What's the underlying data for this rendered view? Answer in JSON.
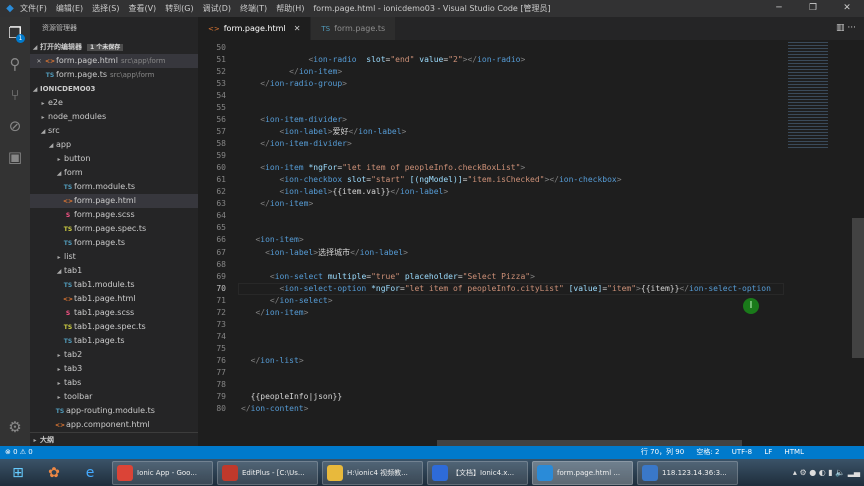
{
  "titlebar": {
    "menu": [
      "文件(F)",
      "编辑(E)",
      "选择(S)",
      "查看(V)",
      "转到(G)",
      "调试(D)",
      "终端(T)",
      "帮助(H)"
    ],
    "title": "form.page.html - ionicdemo03 - Visual Studio Code [管理员]"
  },
  "activity": {
    "explorer_badge": "1"
  },
  "sidebar": {
    "header": "资源管理器",
    "open_editors": {
      "label": "打开的编辑器",
      "unsaved": "1 个未保存",
      "items": [
        {
          "name": "form.page.html",
          "path": "src\\app\\form",
          "type": "html"
        },
        {
          "name": "form.page.ts",
          "path": "src\\app\\form",
          "type": "ts"
        }
      ]
    },
    "project": "IONICDEMO03",
    "tree": [
      {
        "name": "e2e",
        "kind": "folder",
        "depth": 1,
        "open": false
      },
      {
        "name": "node_modules",
        "kind": "folder",
        "depth": 1,
        "open": false
      },
      {
        "name": "src",
        "kind": "folder",
        "depth": 1,
        "open": true
      },
      {
        "name": "app",
        "kind": "folder",
        "depth": 2,
        "open": true
      },
      {
        "name": "button",
        "kind": "folder",
        "depth": 3,
        "open": false
      },
      {
        "name": "form",
        "kind": "folder",
        "depth": 3,
        "open": true
      },
      {
        "name": "form.module.ts",
        "kind": "ts",
        "depth": 4
      },
      {
        "name": "form.page.html",
        "kind": "html",
        "depth": 4,
        "selected": true
      },
      {
        "name": "form.page.scss",
        "kind": "scss",
        "depth": 4
      },
      {
        "name": "form.page.spec.ts",
        "kind": "spec",
        "depth": 4
      },
      {
        "name": "form.page.ts",
        "kind": "ts",
        "depth": 4
      },
      {
        "name": "list",
        "kind": "folder",
        "depth": 3,
        "open": false
      },
      {
        "name": "tab1",
        "kind": "folder",
        "depth": 3,
        "open": true
      },
      {
        "name": "tab1.module.ts",
        "kind": "ts",
        "depth": 4
      },
      {
        "name": "tab1.page.html",
        "kind": "html",
        "depth": 4
      },
      {
        "name": "tab1.page.scss",
        "kind": "scss",
        "depth": 4
      },
      {
        "name": "tab1.page.spec.ts",
        "kind": "spec",
        "depth": 4
      },
      {
        "name": "tab1.page.ts",
        "kind": "ts",
        "depth": 4
      },
      {
        "name": "tab2",
        "kind": "folder",
        "depth": 3,
        "open": false
      },
      {
        "name": "tab3",
        "kind": "folder",
        "depth": 3,
        "open": false
      },
      {
        "name": "tabs",
        "kind": "folder",
        "depth": 3,
        "open": false
      },
      {
        "name": "toolbar",
        "kind": "folder",
        "depth": 3,
        "open": false
      },
      {
        "name": "app-routing.module.ts",
        "kind": "ts",
        "depth": 3
      },
      {
        "name": "app.component.html",
        "kind": "html",
        "depth": 3
      }
    ],
    "outline": "大纲"
  },
  "tabs": [
    {
      "label": "form.page.html",
      "type": "html",
      "active": true
    },
    {
      "label": "form.page.ts",
      "type": "ts",
      "active": false
    }
  ],
  "editor": {
    "current_line": 70,
    "lines": [
      {
        "n": 50,
        "t": []
      },
      {
        "n": 51,
        "t": [
          [
            "t-txt",
            "              "
          ],
          [
            "t-br",
            "<"
          ],
          [
            "t-tag",
            "ion-radio"
          ],
          [
            "t-txt",
            "  "
          ],
          [
            "t-attr",
            "slot"
          ],
          [
            "t-txt",
            "="
          ],
          [
            "t-str",
            "\"end\""
          ],
          [
            "t-txt",
            " "
          ],
          [
            "t-attr",
            "value"
          ],
          [
            "t-txt",
            "="
          ],
          [
            "t-str",
            "\"2\""
          ],
          [
            "t-br",
            "></"
          ],
          [
            "t-tag",
            "ion-radio"
          ],
          [
            "t-br",
            ">"
          ]
        ]
      },
      {
        "n": 52,
        "t": [
          [
            "t-txt",
            "          "
          ],
          [
            "t-br",
            "</"
          ],
          [
            "t-tag",
            "ion-item"
          ],
          [
            "t-br",
            ">"
          ]
        ]
      },
      {
        "n": 53,
        "t": [
          [
            "t-txt",
            "    "
          ],
          [
            "t-br",
            "</"
          ],
          [
            "t-tag",
            "ion-radio-group"
          ],
          [
            "t-br",
            ">"
          ]
        ]
      },
      {
        "n": 54,
        "t": []
      },
      {
        "n": 55,
        "t": []
      },
      {
        "n": 56,
        "t": [
          [
            "t-txt",
            "    "
          ],
          [
            "t-br",
            "<"
          ],
          [
            "t-tag",
            "ion-item-divider"
          ],
          [
            "t-br",
            ">"
          ]
        ]
      },
      {
        "n": 57,
        "t": [
          [
            "t-txt",
            "        "
          ],
          [
            "t-br",
            "<"
          ],
          [
            "t-tag",
            "ion-label"
          ],
          [
            "t-br",
            ">"
          ],
          [
            "t-txt",
            "爱好"
          ],
          [
            "t-br",
            "</"
          ],
          [
            "t-tag",
            "ion-label"
          ],
          [
            "t-br",
            ">"
          ]
        ]
      },
      {
        "n": 58,
        "t": [
          [
            "t-txt",
            "    "
          ],
          [
            "t-br",
            "</"
          ],
          [
            "t-tag",
            "ion-item-divider"
          ],
          [
            "t-br",
            ">"
          ]
        ]
      },
      {
        "n": 59,
        "t": []
      },
      {
        "n": 60,
        "t": [
          [
            "t-txt",
            "    "
          ],
          [
            "t-br",
            "<"
          ],
          [
            "t-tag",
            "ion-item"
          ],
          [
            "t-txt",
            " "
          ],
          [
            "t-attr",
            "*ngFor"
          ],
          [
            "t-txt",
            "="
          ],
          [
            "t-str",
            "\"let item of peopleInfo.checkBoxList\""
          ],
          [
            "t-br",
            ">"
          ]
        ]
      },
      {
        "n": 61,
        "t": [
          [
            "t-txt",
            "        "
          ],
          [
            "t-br",
            "<"
          ],
          [
            "t-tag",
            "ion-checkbox"
          ],
          [
            "t-txt",
            " "
          ],
          [
            "t-attr",
            "slot"
          ],
          [
            "t-txt",
            "="
          ],
          [
            "t-str",
            "\"start\""
          ],
          [
            "t-txt",
            " "
          ],
          [
            "t-attr",
            "[(ngModel)]"
          ],
          [
            "t-txt",
            "="
          ],
          [
            "t-str",
            "\"item.isChecked\""
          ],
          [
            "t-br",
            "></"
          ],
          [
            "t-tag",
            "ion-checkbox"
          ],
          [
            "t-br",
            ">"
          ]
        ]
      },
      {
        "n": 62,
        "t": [
          [
            "t-txt",
            "        "
          ],
          [
            "t-br",
            "<"
          ],
          [
            "t-tag",
            "ion-label"
          ],
          [
            "t-br",
            ">"
          ],
          [
            "t-txt",
            "{{item.val}}"
          ],
          [
            "t-br",
            "</"
          ],
          [
            "t-tag",
            "ion-label"
          ],
          [
            "t-br",
            ">"
          ]
        ]
      },
      {
        "n": 63,
        "t": [
          [
            "t-txt",
            "    "
          ],
          [
            "t-br",
            "</"
          ],
          [
            "t-tag",
            "ion-item"
          ],
          [
            "t-br",
            ">"
          ]
        ]
      },
      {
        "n": 64,
        "t": []
      },
      {
        "n": 65,
        "t": []
      },
      {
        "n": 66,
        "t": [
          [
            "t-txt",
            "   "
          ],
          [
            "t-br",
            "<"
          ],
          [
            "t-tag",
            "ion-item"
          ],
          [
            "t-br",
            ">"
          ]
        ]
      },
      {
        "n": 67,
        "t": [
          [
            "t-txt",
            "     "
          ],
          [
            "t-br",
            "<"
          ],
          [
            "t-tag",
            "ion-label"
          ],
          [
            "t-br",
            ">"
          ],
          [
            "t-txt",
            "选择城市"
          ],
          [
            "t-br",
            "</"
          ],
          [
            "t-tag",
            "ion-label"
          ],
          [
            "t-br",
            ">"
          ]
        ]
      },
      {
        "n": 68,
        "t": []
      },
      {
        "n": 69,
        "t": [
          [
            "t-txt",
            "      "
          ],
          [
            "t-br",
            "<"
          ],
          [
            "t-tag",
            "ion-select"
          ],
          [
            "t-txt",
            " "
          ],
          [
            "t-attr",
            "multiple"
          ],
          [
            "t-txt",
            "="
          ],
          [
            "t-str",
            "\"true\""
          ],
          [
            "t-txt",
            " "
          ],
          [
            "t-attr",
            "placeholder"
          ],
          [
            "t-txt",
            "="
          ],
          [
            "t-str",
            "\"Select Pizza\""
          ],
          [
            "t-br",
            ">"
          ]
        ]
      },
      {
        "n": 70,
        "t": [
          [
            "t-txt",
            "        "
          ],
          [
            "t-br",
            "<"
          ],
          [
            "t-tag",
            "ion-select-option"
          ],
          [
            "t-txt",
            " "
          ],
          [
            "t-attr",
            "*ngFor"
          ],
          [
            "t-txt",
            "="
          ],
          [
            "t-str",
            "\"let item of peopleInfo.cityList\""
          ],
          [
            "t-txt",
            " "
          ],
          [
            "t-attr",
            "[value]"
          ],
          [
            "t-txt",
            "="
          ],
          [
            "t-str",
            "\"item\""
          ],
          [
            "t-br",
            ">"
          ],
          [
            "t-txt",
            "{{item}}"
          ],
          [
            "t-br",
            "</"
          ],
          [
            "t-tag",
            "ion-select-option"
          ]
        ]
      },
      {
        "n": 71,
        "t": [
          [
            "t-txt",
            "      "
          ],
          [
            "t-br",
            "</"
          ],
          [
            "t-tag",
            "ion-select"
          ],
          [
            "t-br",
            ">"
          ]
        ]
      },
      {
        "n": 72,
        "t": [
          [
            "t-txt",
            "   "
          ],
          [
            "t-br",
            "</"
          ],
          [
            "t-tag",
            "ion-item"
          ],
          [
            "t-br",
            ">"
          ]
        ]
      },
      {
        "n": 73,
        "t": []
      },
      {
        "n": 74,
        "t": []
      },
      {
        "n": 75,
        "t": []
      },
      {
        "n": 76,
        "t": [
          [
            "t-txt",
            "  "
          ],
          [
            "t-br",
            "</"
          ],
          [
            "t-tag",
            "ion-list"
          ],
          [
            "t-br",
            ">"
          ]
        ]
      },
      {
        "n": 77,
        "t": []
      },
      {
        "n": 78,
        "t": []
      },
      {
        "n": 79,
        "t": [
          [
            "t-txt",
            "  "
          ],
          [
            "t-txt",
            "{{peopleInfo|json}}"
          ]
        ]
      },
      {
        "n": 80,
        "t": [
          [
            "t-br",
            "</"
          ],
          [
            "t-tag",
            "ion-content"
          ],
          [
            "t-br",
            ">"
          ]
        ]
      }
    ]
  },
  "statusbar": {
    "errors": "0",
    "warnings": "0",
    "position": "行 70，列 90",
    "spaces": "空格: 2",
    "encoding": "UTF-8",
    "eol": "LF",
    "language": "HTML"
  },
  "taskbar": {
    "apps": [
      {
        "label": "Ionic App - Goo...",
        "icon": "chrome-icon",
        "color": "#db4437"
      },
      {
        "label": "EditPlus - [C:\\Us...",
        "icon": "editplus-icon",
        "color": "#c0392b"
      },
      {
        "label": "H:\\ionic4 视频教...",
        "icon": "folder-icon",
        "color": "#e8b93c"
      },
      {
        "label": "【文档】Ionic4.x...",
        "icon": "docs-icon",
        "color": "#2e6bd8"
      },
      {
        "label": "form.page.html ...",
        "icon": "vscode-icon",
        "color": "#2a8bd8",
        "active": true
      },
      {
        "label": "118.123.14.36:3...",
        "icon": "remote-desktop-icon",
        "color": "#3a78c8"
      }
    ]
  }
}
